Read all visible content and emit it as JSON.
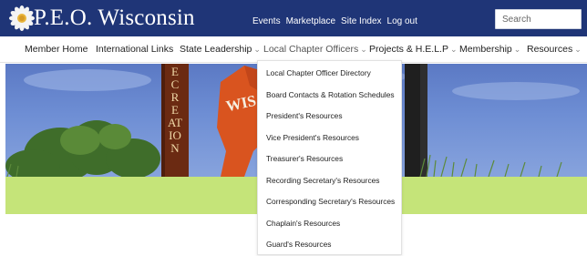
{
  "header": {
    "logo_text": "P.E.O. Wisconsin",
    "util_links": [
      "Events",
      "Marketplace",
      "Site Index",
      "Log out"
    ],
    "search_placeholder": "Search",
    "colors": {
      "topbar": "#1f3577",
      "hero_sky": "#6e8ed4",
      "green_band": "#c5e479"
    }
  },
  "nav": {
    "items": [
      {
        "label": "Member Home",
        "has_menu": false
      },
      {
        "label": "International Links",
        "has_menu": false
      },
      {
        "label": "State Leadership",
        "has_menu": true
      },
      {
        "label": "Local Chapter Officers",
        "has_menu": true
      },
      {
        "label": "Projects & H.E.L.P",
        "has_menu": true
      },
      {
        "label": "Membership",
        "has_menu": true
      },
      {
        "label": "Resources",
        "has_menu": true
      }
    ],
    "caret": "⌄",
    "active_index": 3
  },
  "hero": {
    "sign_text_vertical": "ECREATION",
    "sign_text_red": "WIS"
  },
  "dropdown": {
    "items": [
      "Local Chapter Officer Directory",
      "Board Contacts & Rotation Schedules",
      "President's Resources",
      "Vice President's Resources",
      "Treasurer's Resources",
      "Recording Secretary's Resources",
      "Corresponding Secretary's Resources",
      "Chaplain's Resources",
      "Guard's Resources"
    ]
  }
}
